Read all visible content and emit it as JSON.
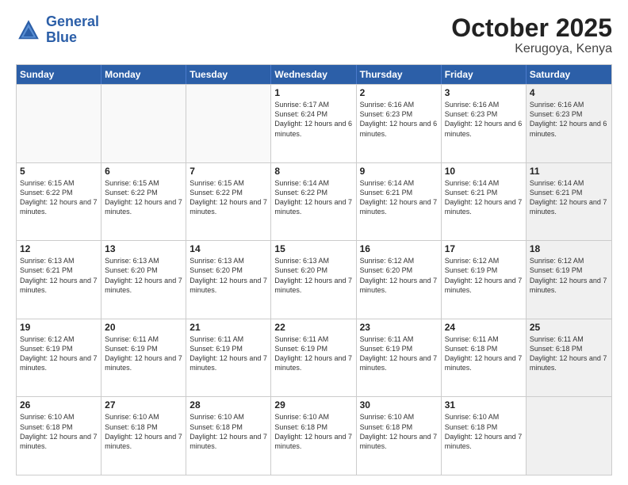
{
  "header": {
    "logo_line1": "General",
    "logo_line2": "Blue",
    "month": "October 2025",
    "location": "Kerugoya, Kenya"
  },
  "days_of_week": [
    "Sunday",
    "Monday",
    "Tuesday",
    "Wednesday",
    "Thursday",
    "Friday",
    "Saturday"
  ],
  "weeks": [
    [
      {
        "day": "",
        "info": "",
        "empty": true
      },
      {
        "day": "",
        "info": "",
        "empty": true
      },
      {
        "day": "",
        "info": "",
        "empty": true
      },
      {
        "day": "1",
        "info": "Sunrise: 6:17 AM\nSunset: 6:24 PM\nDaylight: 12 hours\nand 6 minutes."
      },
      {
        "day": "2",
        "info": "Sunrise: 6:16 AM\nSunset: 6:23 PM\nDaylight: 12 hours\nand 6 minutes."
      },
      {
        "day": "3",
        "info": "Sunrise: 6:16 AM\nSunset: 6:23 PM\nDaylight: 12 hours\nand 6 minutes."
      },
      {
        "day": "4",
        "info": "Sunrise: 6:16 AM\nSunset: 6:23 PM\nDaylight: 12 hours\nand 6 minutes.",
        "shaded": true
      }
    ],
    [
      {
        "day": "5",
        "info": "Sunrise: 6:15 AM\nSunset: 6:22 PM\nDaylight: 12 hours\nand 7 minutes."
      },
      {
        "day": "6",
        "info": "Sunrise: 6:15 AM\nSunset: 6:22 PM\nDaylight: 12 hours\nand 7 minutes."
      },
      {
        "day": "7",
        "info": "Sunrise: 6:15 AM\nSunset: 6:22 PM\nDaylight: 12 hours\nand 7 minutes."
      },
      {
        "day": "8",
        "info": "Sunrise: 6:14 AM\nSunset: 6:22 PM\nDaylight: 12 hours\nand 7 minutes."
      },
      {
        "day": "9",
        "info": "Sunrise: 6:14 AM\nSunset: 6:21 PM\nDaylight: 12 hours\nand 7 minutes."
      },
      {
        "day": "10",
        "info": "Sunrise: 6:14 AM\nSunset: 6:21 PM\nDaylight: 12 hours\nand 7 minutes."
      },
      {
        "day": "11",
        "info": "Sunrise: 6:14 AM\nSunset: 6:21 PM\nDaylight: 12 hours\nand 7 minutes.",
        "shaded": true
      }
    ],
    [
      {
        "day": "12",
        "info": "Sunrise: 6:13 AM\nSunset: 6:21 PM\nDaylight: 12 hours\nand 7 minutes."
      },
      {
        "day": "13",
        "info": "Sunrise: 6:13 AM\nSunset: 6:20 PM\nDaylight: 12 hours\nand 7 minutes."
      },
      {
        "day": "14",
        "info": "Sunrise: 6:13 AM\nSunset: 6:20 PM\nDaylight: 12 hours\nand 7 minutes."
      },
      {
        "day": "15",
        "info": "Sunrise: 6:13 AM\nSunset: 6:20 PM\nDaylight: 12 hours\nand 7 minutes."
      },
      {
        "day": "16",
        "info": "Sunrise: 6:12 AM\nSunset: 6:20 PM\nDaylight: 12 hours\nand 7 minutes."
      },
      {
        "day": "17",
        "info": "Sunrise: 6:12 AM\nSunset: 6:19 PM\nDaylight: 12 hours\nand 7 minutes."
      },
      {
        "day": "18",
        "info": "Sunrise: 6:12 AM\nSunset: 6:19 PM\nDaylight: 12 hours\nand 7 minutes.",
        "shaded": true
      }
    ],
    [
      {
        "day": "19",
        "info": "Sunrise: 6:12 AM\nSunset: 6:19 PM\nDaylight: 12 hours\nand 7 minutes."
      },
      {
        "day": "20",
        "info": "Sunrise: 6:11 AM\nSunset: 6:19 PM\nDaylight: 12 hours\nand 7 minutes."
      },
      {
        "day": "21",
        "info": "Sunrise: 6:11 AM\nSunset: 6:19 PM\nDaylight: 12 hours\nand 7 minutes."
      },
      {
        "day": "22",
        "info": "Sunrise: 6:11 AM\nSunset: 6:19 PM\nDaylight: 12 hours\nand 7 minutes."
      },
      {
        "day": "23",
        "info": "Sunrise: 6:11 AM\nSunset: 6:19 PM\nDaylight: 12 hours\nand 7 minutes."
      },
      {
        "day": "24",
        "info": "Sunrise: 6:11 AM\nSunset: 6:18 PM\nDaylight: 12 hours\nand 7 minutes."
      },
      {
        "day": "25",
        "info": "Sunrise: 6:11 AM\nSunset: 6:18 PM\nDaylight: 12 hours\nand 7 minutes.",
        "shaded": true
      }
    ],
    [
      {
        "day": "26",
        "info": "Sunrise: 6:10 AM\nSunset: 6:18 PM\nDaylight: 12 hours\nand 7 minutes."
      },
      {
        "day": "27",
        "info": "Sunrise: 6:10 AM\nSunset: 6:18 PM\nDaylight: 12 hours\nand 7 minutes."
      },
      {
        "day": "28",
        "info": "Sunrise: 6:10 AM\nSunset: 6:18 PM\nDaylight: 12 hours\nand 7 minutes."
      },
      {
        "day": "29",
        "info": "Sunrise: 6:10 AM\nSunset: 6:18 PM\nDaylight: 12 hours\nand 7 minutes."
      },
      {
        "day": "30",
        "info": "Sunrise: 6:10 AM\nSunset: 6:18 PM\nDaylight: 12 hours\nand 7 minutes."
      },
      {
        "day": "31",
        "info": "Sunrise: 6:10 AM\nSunset: 6:18 PM\nDaylight: 12 hours\nand 7 minutes."
      },
      {
        "day": "",
        "info": "",
        "empty": true,
        "shaded": true
      }
    ]
  ]
}
